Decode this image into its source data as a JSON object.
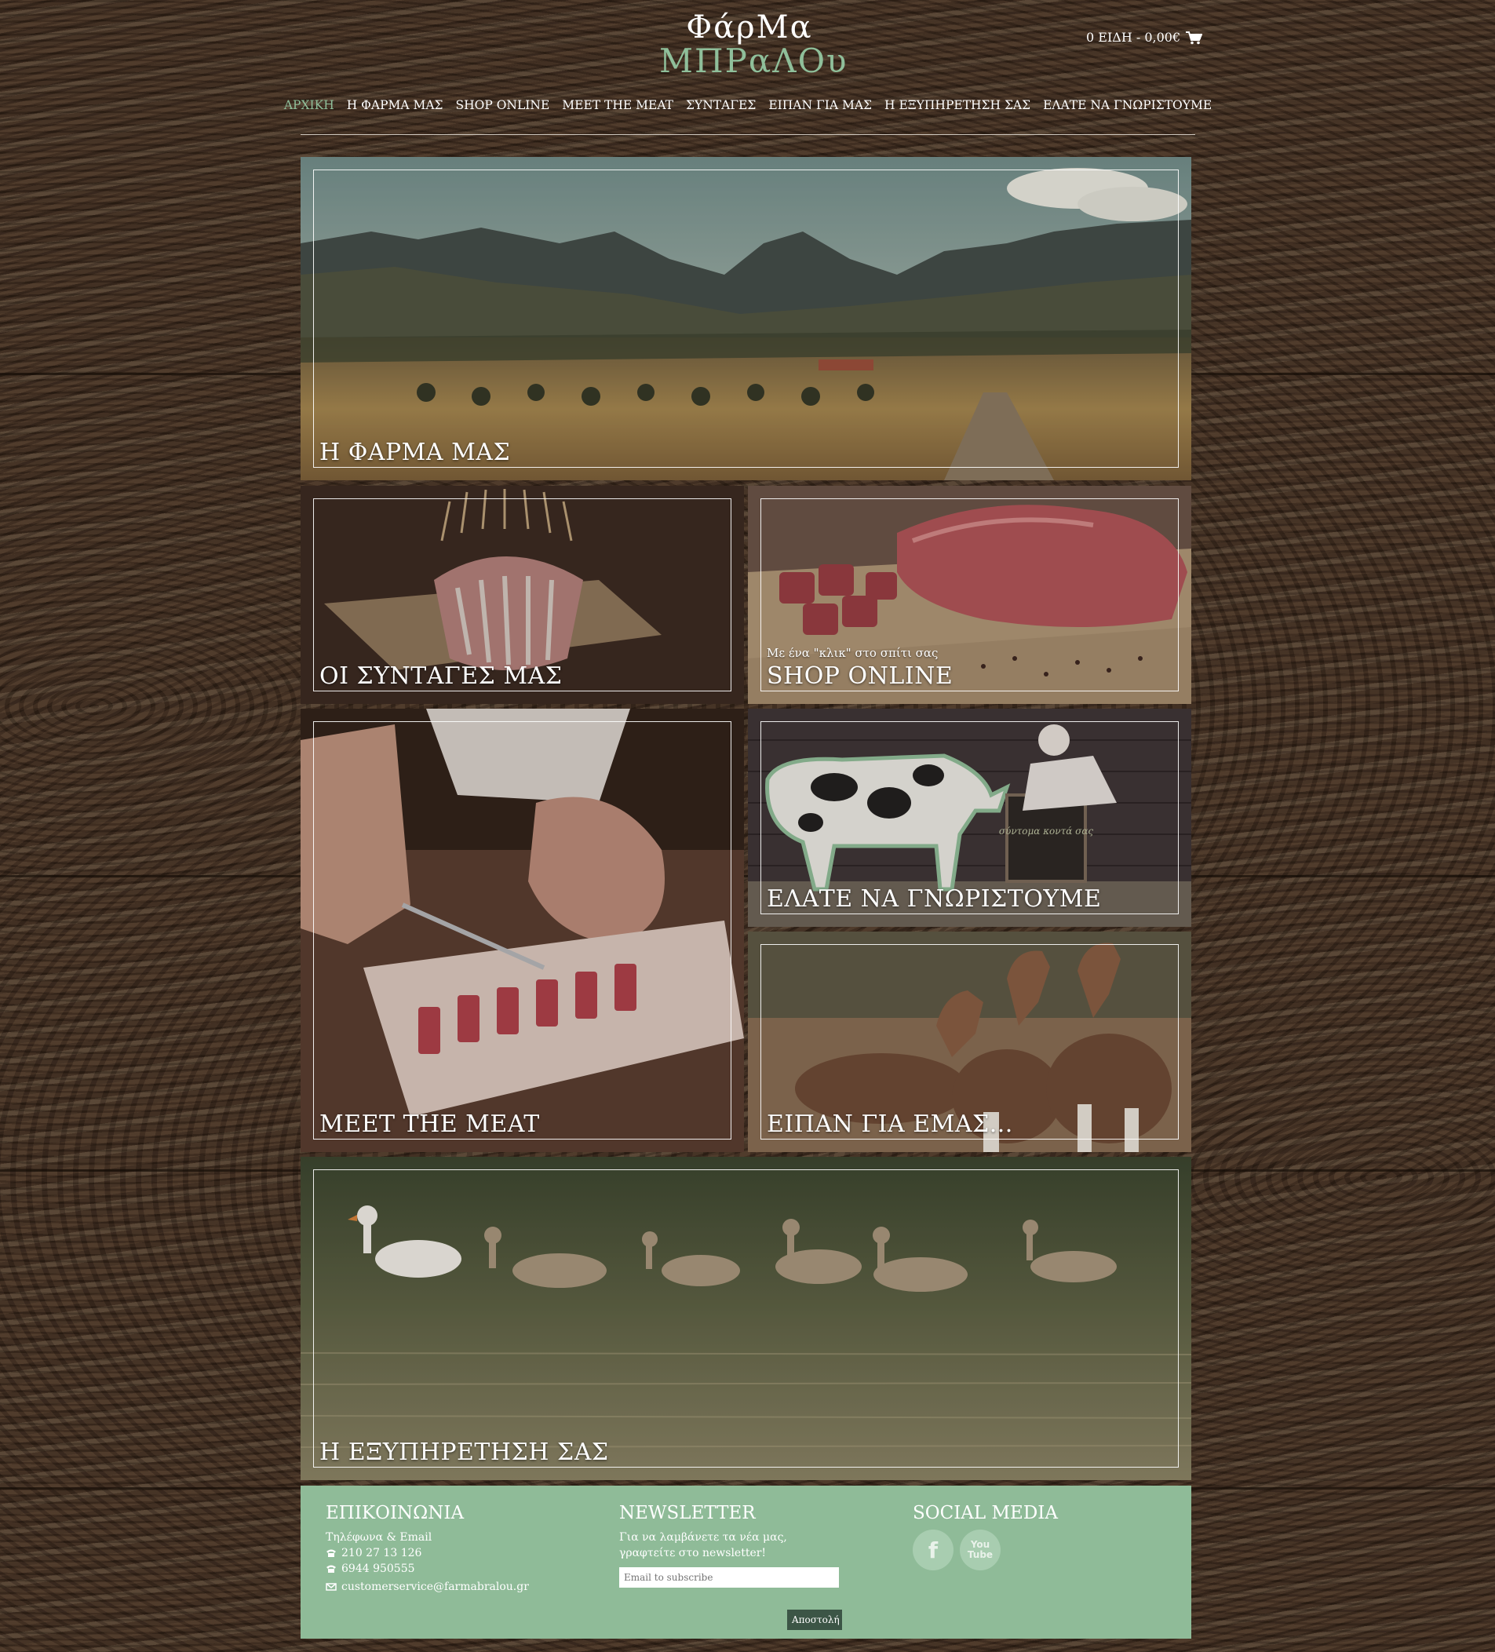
{
  "header": {
    "logo_top": "ΦάρΜα",
    "logo_bottom": "ΜΠΡαΛΟυ",
    "cart_text": "0 ΕΙΔΗ - 0,00€"
  },
  "nav": {
    "items": [
      {
        "label": "ΑΡΧΙΚΗ",
        "active": true
      },
      {
        "label": "Η ΦΑΡΜΑ ΜΑΣ"
      },
      {
        "label": "SHOP ONLINE"
      },
      {
        "label": "MEET THE MEAT"
      },
      {
        "label": "ΣΥΝΤΑΓΕΣ"
      },
      {
        "label": "ΕΙΠΑΝ ΓΙΑ ΜΑΣ"
      },
      {
        "label": "Η ΕΞΥΠΗΡΕΤΗΣΗ ΣΑΣ"
      },
      {
        "label": "ΕΛΑΤΕ ΝΑ ΓΝΩΡΙΣΤΟΥΜΕ"
      }
    ]
  },
  "tiles": {
    "farm": {
      "label": "Η ΦΑΡΜΑ ΜΑΣ"
    },
    "recipes": {
      "label": "ΟΙ ΣΥΝΤΑΓΕΣ ΜΑΣ"
    },
    "shop": {
      "label": "SHOP ONLINE",
      "sub": "Με ένα \"κλικ\" στο σπίτι σας"
    },
    "meat": {
      "label": "MEET THE MEAT"
    },
    "visit": {
      "label": "ΕΛΑΤΕ ΝΑ ΓΝΩΡΙΣΤΟΥΜΕ",
      "chalkboard": "σύντομα κοντά σας"
    },
    "reviews": {
      "label": "ΕΙΠΑΝ ΓΙΑ ΕΜΑΣ..."
    },
    "service": {
      "label": "Η ΕΞΥΠΗΡΕΤΗΣΗ ΣΑΣ"
    }
  },
  "footer": {
    "contact": {
      "title": "ΕΠΙΚΟΙΝΩΝΙΑ",
      "subtitle": "Τηλέφωνα & Email",
      "phone1": "210 27 13 126",
      "phone2": "6944 950555",
      "email": "customerservice@farmabralou.gr"
    },
    "newsletter": {
      "title": "NEWSLETTER",
      "text": "Για να λαμβάνετε τα νέα μας, γραφτείτε στο newsletter!",
      "placeholder": "Email to subscribe",
      "button": "Αποστολή"
    },
    "social": {
      "title": "SOCIAL MEDIA",
      "facebook": "f",
      "youtube": "You Tube"
    }
  },
  "colors": {
    "accent": "#8fbf9a",
    "footer_bg": "#8fbb98",
    "button_bg": "#3c5546"
  }
}
